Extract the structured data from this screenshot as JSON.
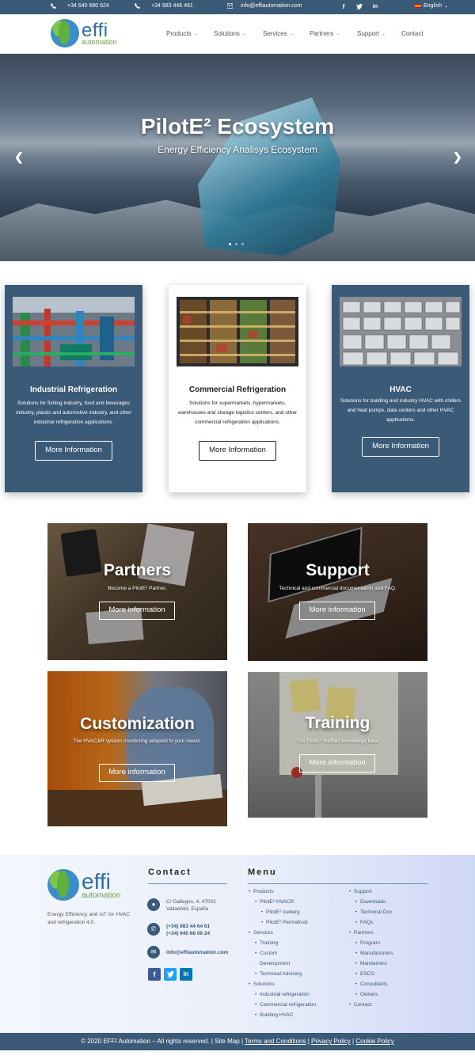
{
  "topbar": {
    "phone1": "+34 640 680 624",
    "phone2": "+34 983 446 461",
    "email": "info@effiautomation.com",
    "language": "English"
  },
  "logo": {
    "word": "effi",
    "tagline": "automation"
  },
  "nav": [
    "Products",
    "Solutions",
    "Services",
    "Partners",
    "Support",
    "Contact"
  ],
  "hero": {
    "title": "PilotE² Ecosystem",
    "subtitle": "Energy Efficiency Analisys Ecosystem",
    "slides_total": 3,
    "active_slide": 1
  },
  "cards": [
    {
      "title": "Industrial Refrigeration",
      "text": "Solutions for fishing industry, food and beverages industry, plastic and automotive industry, and other industrial refrigeration applications.",
      "button": "More Information"
    },
    {
      "title": "Commercial Refrigeration",
      "text": "Solutions for supermarkets, hypermarkets, warehouses and storage logistics centers, and other commercial refrigeration applications.",
      "button": "More Information"
    },
    {
      "title": "HVAC",
      "text": "Solutions for building and industry HVAC with chillers and heat pumps, data centers and other HVAC applications.",
      "button": "More Information"
    }
  ],
  "tiles": [
    {
      "title": "Partners",
      "text": "Become a PilotE² Partner.",
      "button": "More information"
    },
    {
      "title": "Support",
      "text": "Technical and commercial documentation and FAQ.",
      "button": "More information"
    },
    {
      "title": "Customization",
      "text": "The HVAC&R system monitoring adapted to your needs.",
      "button": "More information"
    },
    {
      "title": "Training",
      "text": "The PilotE² method knowledge base",
      "button": "More information"
    }
  ],
  "footer": {
    "tagline": "Energy Efficiency and IoT for HVAC and refrigeration 4.0.",
    "contact_heading": "Contact",
    "address1": "C/ Gallegos, 4, 47002",
    "address2": "Valladolid, España",
    "phone1": "(+34) 983 44 64 61",
    "phone2": "(+34) 640 68 06 24",
    "email": "info@effiautomation.com",
    "menu_heading": "Menu",
    "menu_left": [
      "Products",
      "PilotE² HVACR",
      "PilotE² Iceberg",
      "PilotE² Permafrost",
      "Services",
      "Training",
      "Custom",
      "Development",
      "Technical Advising",
      "Solutions",
      "Industrial refrigeration",
      "Commercial refrigeration",
      "Building HVAC"
    ],
    "menu_right": [
      "Support",
      "Downloads",
      "Technical Doc",
      "FAQs",
      "Partners",
      "Program",
      "Manufacturers",
      "Maintainers",
      "ESCO",
      "Consultants",
      "Owners",
      "Contact"
    ],
    "copyright": "© 2020 EFFI Automation – All rights reserved. |",
    "sitemap": "Site Map",
    "terms": "Terms and Conditions",
    "privacy": "Privacy Policy",
    "cookie": "Cookie Policy"
  },
  "colors": {
    "brand_blue": "#3a5a78",
    "logo_blue": "#2f6fa8",
    "logo_green": "#6ba33a"
  },
  "icons": [
    "phone-icon",
    "email-icon",
    "facebook-icon",
    "twitter-icon",
    "linkedin-icon",
    "chevron-left-icon",
    "chevron-right-icon",
    "location-icon"
  ]
}
